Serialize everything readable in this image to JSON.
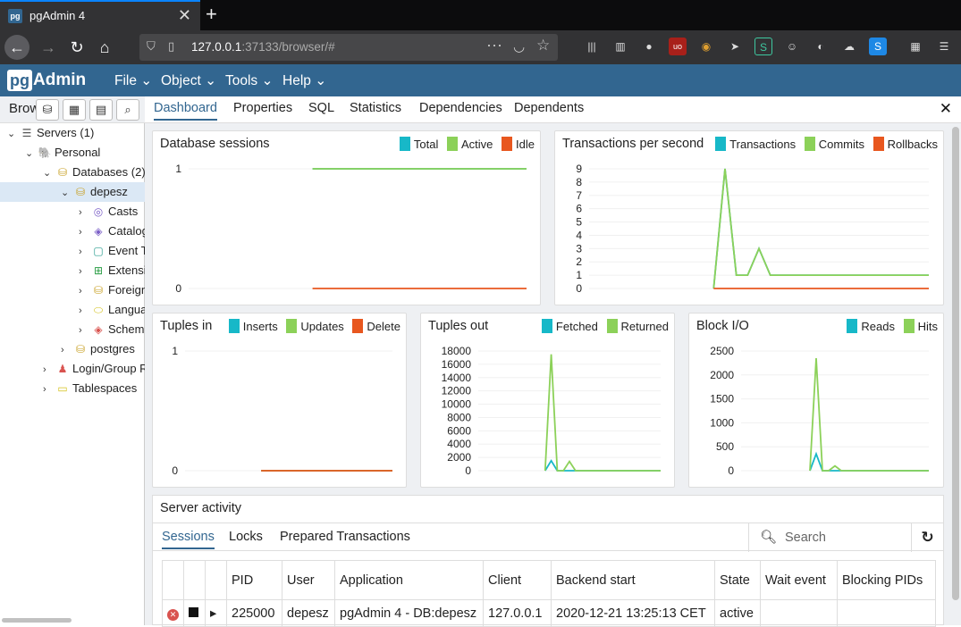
{
  "browser": {
    "tab_title": "pgAdmin 4",
    "tab_favicon": "pg",
    "url_host": "127.0.0.1",
    "url_rest": ":37133/browser/#"
  },
  "app": {
    "logo_pg": "pg",
    "logo_admin": "Admin",
    "menus": [
      "File",
      "Object",
      "Tools",
      "Help"
    ],
    "accent": "#326690"
  },
  "left": {
    "title": "Brow",
    "tree": [
      {
        "label": "Servers (1)",
        "icon": "servers-icon",
        "glyph": "☰",
        "color": "#555",
        "chev": "⌄"
      },
      {
        "label": "Personal",
        "icon": "elephant-icon",
        "glyph": "🐘",
        "color": "#326690",
        "chev": "⌄"
      },
      {
        "label": "Databases (2)",
        "icon": "databases-icon",
        "glyph": "⛁",
        "color": "#c9a227",
        "chev": "⌄"
      },
      {
        "label": "depesz",
        "icon": "database-icon",
        "glyph": "⛁",
        "color": "#c9a227",
        "chev": "⌄"
      },
      {
        "label": "Casts",
        "icon": "casts-icon",
        "glyph": "◎",
        "color": "#7b5fc7",
        "chev": "›"
      },
      {
        "label": "Catalog",
        "icon": "catalog-icon",
        "glyph": "◈",
        "color": "#7b5fc7",
        "chev": "›"
      },
      {
        "label": "Event T",
        "icon": "event-trigger-icon",
        "glyph": "▢",
        "color": "#2a9d8f",
        "chev": "›"
      },
      {
        "label": "Extensi",
        "icon": "extensions-icon",
        "glyph": "⊞",
        "color": "#2a9d44",
        "chev": "›"
      },
      {
        "label": "Foreign",
        "icon": "foreign-data-icon",
        "glyph": "⛁",
        "color": "#c9a227",
        "chev": "›"
      },
      {
        "label": "Langua",
        "icon": "languages-icon",
        "glyph": "⬭",
        "color": "#d4c21f",
        "chev": "›"
      },
      {
        "label": "Schem",
        "icon": "schemas-icon",
        "glyph": "◈",
        "color": "#d9534f",
        "chev": "›"
      },
      {
        "label": "postgres",
        "icon": "database-icon",
        "glyph": "⛁",
        "color": "#c9a227",
        "chev": "›"
      },
      {
        "label": "Login/Group R",
        "icon": "login-roles-icon",
        "glyph": "♟",
        "color": "#d9534f",
        "chev": "›"
      },
      {
        "label": "Tablespaces",
        "icon": "tablespaces-icon",
        "glyph": "▭",
        "color": "#d4c21f",
        "chev": "›"
      }
    ]
  },
  "right": {
    "tabs": [
      "Dashboard",
      "Properties",
      "SQL",
      "Statistics",
      "Dependencies",
      "Dependents"
    ]
  },
  "charts": {
    "sessions": {
      "title": "Database sessions",
      "legend": [
        "Total",
        "Active",
        "Idle"
      ]
    },
    "tps": {
      "title": "Transactions per second",
      "legend": [
        "Transactions",
        "Commits",
        "Rollbacks"
      ]
    },
    "tuples_in": {
      "title": "Tuples in",
      "legend": [
        "Inserts",
        "Updates",
        "Delete"
      ]
    },
    "tuples_out": {
      "title": "Tuples out",
      "legend": [
        "Fetched",
        "Returned"
      ]
    },
    "block_io": {
      "title": "Block I/O",
      "legend": [
        "Reads",
        "Hits"
      ]
    }
  },
  "chart_data": [
    {
      "type": "line",
      "title": "Database sessions",
      "ylim": [
        0,
        1
      ],
      "yticks": [
        0,
        1
      ],
      "colors": [
        "#17b8c8",
        "#8cd159",
        "#e8571f"
      ],
      "series": [
        {
          "name": "Total",
          "values": [
            null,
            null,
            null,
            null,
            null,
            null,
            null,
            null,
            null,
            null,
            null,
            1,
            1,
            1,
            1,
            1,
            1,
            1,
            1,
            1,
            1,
            1,
            1,
            1,
            1,
            1,
            1,
            1,
            1,
            1,
            1
          ]
        },
        {
          "name": "Active",
          "values": [
            null,
            null,
            null,
            null,
            null,
            null,
            null,
            null,
            null,
            null,
            null,
            1,
            1,
            1,
            1,
            1,
            1,
            1,
            1,
            1,
            1,
            1,
            1,
            1,
            1,
            1,
            1,
            1,
            1,
            1,
            1
          ]
        },
        {
          "name": "Idle",
          "values": [
            null,
            null,
            null,
            null,
            null,
            null,
            null,
            null,
            null,
            null,
            null,
            0,
            0,
            0,
            0,
            0,
            0,
            0,
            0,
            0,
            0,
            0,
            0,
            0,
            0,
            0,
            0,
            0,
            0,
            0,
            0
          ]
        }
      ]
    },
    {
      "type": "line",
      "title": "Transactions per second",
      "ylim": [
        0,
        9
      ],
      "yticks": [
        0,
        1,
        2,
        3,
        4,
        5,
        6,
        7,
        8,
        9
      ],
      "colors": [
        "#17b8c8",
        "#8cd159",
        "#e8571f"
      ],
      "series": [
        {
          "name": "Transactions",
          "values": [
            null,
            null,
            null,
            null,
            null,
            null,
            null,
            null,
            null,
            null,
            null,
            0,
            9,
            1,
            1,
            3,
            1,
            1,
            1,
            1,
            1,
            1,
            1,
            1,
            1,
            1,
            1,
            1,
            1,
            1,
            1
          ]
        },
        {
          "name": "Commits",
          "values": [
            null,
            null,
            null,
            null,
            null,
            null,
            null,
            null,
            null,
            null,
            null,
            0,
            9,
            1,
            1,
            3,
            1,
            1,
            1,
            1,
            1,
            1,
            1,
            1,
            1,
            1,
            1,
            1,
            1,
            1,
            1
          ]
        },
        {
          "name": "Rollbacks",
          "values": [
            null,
            null,
            null,
            null,
            null,
            null,
            null,
            null,
            null,
            null,
            null,
            0,
            0,
            0,
            0,
            0,
            0,
            0,
            0,
            0,
            0,
            0,
            0,
            0,
            0,
            0,
            0,
            0,
            0,
            0,
            0
          ]
        }
      ]
    },
    {
      "type": "line",
      "title": "Tuples in",
      "ylim": [
        0,
        1
      ],
      "yticks": [
        0,
        1
      ],
      "colors": [
        "#17b8c8",
        "#8cd159",
        "#e8571f"
      ],
      "series": [
        {
          "name": "Inserts",
          "values": [
            null,
            null,
            null,
            null,
            null,
            null,
            null,
            null,
            null,
            null,
            null,
            0,
            0,
            0,
            0,
            0,
            0,
            0,
            0,
            0,
            0,
            0,
            0,
            0,
            0,
            0,
            0,
            0,
            0,
            0,
            0
          ]
        },
        {
          "name": "Updates",
          "values": [
            null,
            null,
            null,
            null,
            null,
            null,
            null,
            null,
            null,
            null,
            null,
            0,
            0,
            0,
            0,
            0,
            0,
            0,
            0,
            0,
            0,
            0,
            0,
            0,
            0,
            0,
            0,
            0,
            0,
            0,
            0
          ]
        },
        {
          "name": "Delete",
          "values": [
            null,
            null,
            null,
            null,
            null,
            null,
            null,
            null,
            null,
            null,
            null,
            0,
            0,
            0,
            0,
            0,
            0,
            0,
            0,
            0,
            0,
            0,
            0,
            0,
            0,
            0,
            0,
            0,
            0,
            0,
            0
          ]
        }
      ]
    },
    {
      "type": "line",
      "title": "Tuples out",
      "ylim": [
        0,
        18000
      ],
      "yticks": [
        0,
        2000,
        4000,
        6000,
        8000,
        10000,
        12000,
        14000,
        16000,
        18000
      ],
      "colors": [
        "#17b8c8",
        "#8cd159"
      ],
      "series": [
        {
          "name": "Fetched",
          "values": [
            null,
            null,
            null,
            null,
            null,
            null,
            null,
            null,
            null,
            null,
            null,
            0,
            1500,
            0,
            0,
            0,
            0,
            0,
            0,
            0,
            0,
            0,
            0,
            0,
            0,
            0,
            0,
            0,
            0,
            0,
            0
          ]
        },
        {
          "name": "Returned",
          "values": [
            null,
            null,
            null,
            null,
            null,
            null,
            null,
            null,
            null,
            null,
            null,
            0,
            17500,
            0,
            0,
            1400,
            0,
            0,
            0,
            0,
            0,
            0,
            0,
            0,
            0,
            0,
            0,
            0,
            0,
            0,
            0
          ]
        }
      ]
    },
    {
      "type": "line",
      "title": "Block I/O",
      "ylim": [
        0,
        2500
      ],
      "yticks": [
        0,
        500,
        1000,
        1500,
        2000,
        2500
      ],
      "colors": [
        "#17b8c8",
        "#8cd159"
      ],
      "series": [
        {
          "name": "Reads",
          "values": [
            null,
            null,
            null,
            null,
            null,
            null,
            null,
            null,
            null,
            null,
            null,
            0,
            350,
            0,
            0,
            0,
            0,
            0,
            0,
            0,
            0,
            0,
            0,
            0,
            0,
            0,
            0,
            0,
            0,
            0,
            0
          ]
        },
        {
          "name": "Hits",
          "values": [
            null,
            null,
            null,
            null,
            null,
            null,
            null,
            null,
            null,
            null,
            null,
            0,
            2350,
            0,
            0,
            100,
            0,
            0,
            0,
            0,
            0,
            0,
            0,
            0,
            0,
            0,
            0,
            0,
            0,
            0,
            0
          ]
        }
      ]
    }
  ],
  "activity": {
    "title": "Server activity",
    "tabs": [
      "Sessions",
      "Locks",
      "Prepared Transactions"
    ],
    "search_placeholder": "Search",
    "columns": [
      "PID",
      "User",
      "Application",
      "Client",
      "Backend start",
      "State",
      "Wait event",
      "Blocking PIDs"
    ],
    "rows": [
      {
        "pid": "225000",
        "user": "depesz",
        "application": "pgAdmin 4 - DB:depesz",
        "client": "127.0.0.1",
        "backend_start": "2020-12-21 13:25:13 CET",
        "state": "active",
        "wait_event": "",
        "blocking_pids": ""
      }
    ]
  }
}
